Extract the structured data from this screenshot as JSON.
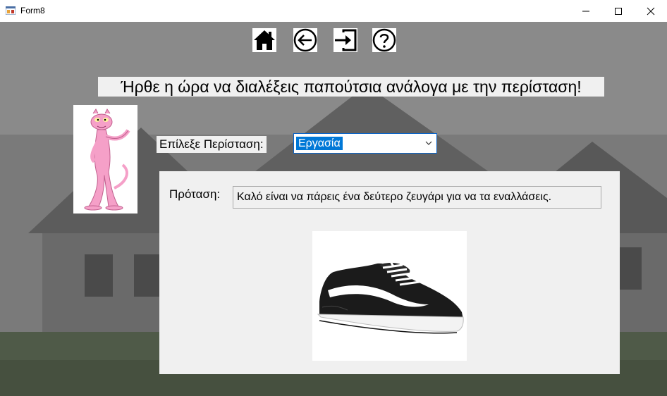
{
  "window": {
    "title": "Form8",
    "icons": {
      "app": "winforms-app-icon",
      "minimize": "minimize-icon",
      "maximize": "maximize-icon",
      "close": "close-icon"
    }
  },
  "nav": {
    "items": [
      {
        "icon": "home-icon"
      },
      {
        "icon": "back-arrow-icon"
      },
      {
        "icon": "exit-icon"
      },
      {
        "icon": "help-icon"
      }
    ]
  },
  "heading": "Ήρθε η ώρα να διαλέξεις παπούτσια ανάλογα με την περίσταση!",
  "occasion": {
    "label": "Επίλεξε Περίσταση:",
    "selected": "Εργασία"
  },
  "suggestion": {
    "label": "Πρόταση:",
    "text": "Καλό είναι να πάρεις ένα δεύτερο ζευγάρι για να τα εναλλάσεις."
  },
  "images": {
    "character": "pink-panther-image",
    "shoe": "black-sneaker-image"
  },
  "colors": {
    "selection": "#0078d7",
    "panel": "#f0f0f0",
    "panther_pink": "#f5a0c8"
  }
}
